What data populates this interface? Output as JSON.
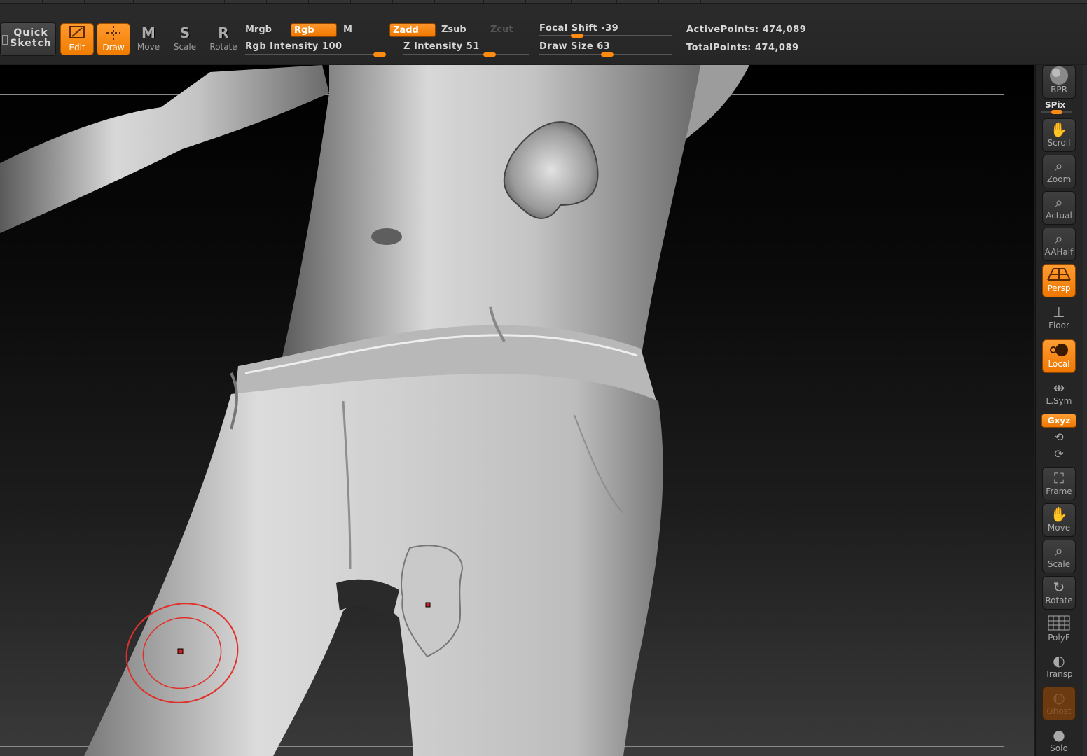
{
  "toolbar": {
    "quick_sketch": "Quick\nSketch",
    "edit": "Edit",
    "draw": "Draw",
    "move": "Move",
    "scale": "Scale",
    "rotate": "Rotate",
    "move_key": "M",
    "scale_key": "S",
    "rotate_key": "R"
  },
  "modes": {
    "mrgb": "Mrgb",
    "rgb": "Rgb",
    "m": "M",
    "zadd": "Zadd",
    "zsub": "Zsub",
    "zcut": "Zcut"
  },
  "sliders": {
    "rgb_intensity": "Rgb Intensity 100",
    "z_intensity": "Z Intensity 51",
    "focal_shift": "Focal Shift -39",
    "draw_size": "Draw Size 63"
  },
  "stats": {
    "active_points": "ActivePoints: 474,089",
    "total_points": "TotalPoints: 474,089"
  },
  "tray": {
    "bpr": "BPR",
    "spix": "SPix",
    "scroll": "Scroll",
    "zoom": "Zoom",
    "actual": "Actual",
    "aahalf": "AAHalf",
    "persp": "Persp",
    "floor": "Floor",
    "local": "Local",
    "lsym": "L.Sym",
    "xyz": "Gxyz",
    "frame": "Frame",
    "move": "Move",
    "scale": "Scale",
    "rotate": "Rotate",
    "polyf": "PolyF",
    "transp": "Transp",
    "ghost": "Ghost",
    "solo": "Solo"
  },
  "colors": {
    "accent": "#f28000",
    "brush_ring": "#e0302a"
  }
}
